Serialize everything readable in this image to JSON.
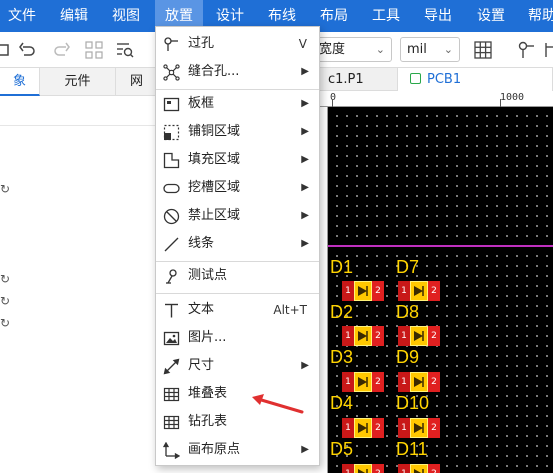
{
  "menubar": {
    "items": [
      "文件",
      "编辑",
      "视图",
      "放置",
      "设计",
      "布线",
      "布局",
      "工具",
      "导出",
      "设置",
      "帮助"
    ],
    "active_index": 3,
    "bg_color": "#1f6fd6"
  },
  "toolbar": {
    "width_select": "宽度",
    "unit_select": "mil"
  },
  "left_panel": {
    "tabs": [
      "象",
      "元件",
      "网"
    ]
  },
  "doc_tabs": {
    "schematic": "c1.P1",
    "pcb": "PCB1"
  },
  "ruler": {
    "labels": [
      "0",
      "1000"
    ]
  },
  "canvas": {
    "designators": [
      "D1",
      "D7",
      "D2",
      "D8",
      "D3",
      "D9",
      "D4",
      "D10",
      "D5",
      "D11"
    ],
    "pad_numbers": [
      "1",
      "2"
    ]
  },
  "place_menu": {
    "items": [
      {
        "label": "过孔",
        "shortcut": "V",
        "submenu": false,
        "icon": "via-icon"
      },
      {
        "label": "缝合孔...",
        "shortcut": "",
        "submenu": true,
        "icon": "stitch-via-icon"
      },
      {
        "label": "板框",
        "shortcut": "",
        "submenu": true,
        "icon": "board-outline-icon"
      },
      {
        "label": "铺铜区域",
        "shortcut": "",
        "submenu": true,
        "icon": "copper-pour-icon"
      },
      {
        "label": "填充区域",
        "shortcut": "",
        "submenu": true,
        "icon": "fill-region-icon"
      },
      {
        "label": "挖槽区域",
        "shortcut": "",
        "submenu": true,
        "icon": "slot-region-icon"
      },
      {
        "label": "禁止区域",
        "shortcut": "",
        "submenu": true,
        "icon": "keepout-region-icon"
      },
      {
        "label": "线条",
        "shortcut": "",
        "submenu": true,
        "icon": "line-icon"
      },
      {
        "label": "测试点",
        "shortcut": "",
        "submenu": false,
        "icon": "test-point-icon"
      },
      {
        "label": "文本",
        "shortcut": "Alt+T",
        "submenu": false,
        "icon": "text-icon"
      },
      {
        "label": "图片...",
        "shortcut": "",
        "submenu": false,
        "icon": "image-icon"
      },
      {
        "label": "尺寸",
        "shortcut": "",
        "submenu": true,
        "icon": "dimension-icon"
      },
      {
        "label": "堆叠表",
        "shortcut": "",
        "submenu": false,
        "icon": "stackup-table-icon"
      },
      {
        "label": "钻孔表",
        "shortcut": "",
        "submenu": false,
        "icon": "drill-table-icon"
      },
      {
        "label": "画布原点",
        "shortcut": "",
        "submenu": true,
        "icon": "canvas-origin-icon"
      }
    ]
  },
  "annotation": {
    "arrow_color": "#e03030",
    "arrow_target": "堆叠表"
  }
}
